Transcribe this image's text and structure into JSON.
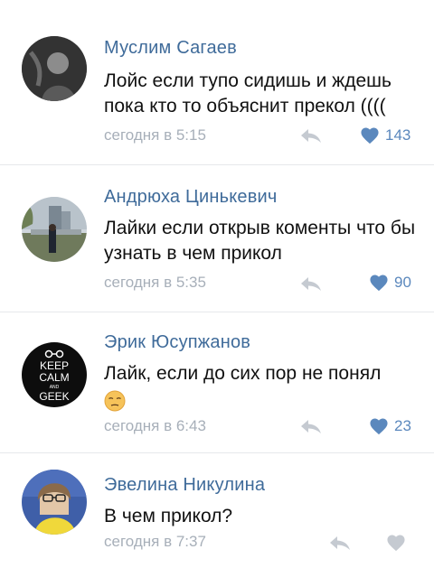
{
  "comments": [
    {
      "author": "Муслим Сагаев",
      "text": "Лойс если тупо сидишь и ждешь пока кто то объяснит прекол ((((",
      "time": "сегодня в 5:15",
      "likes": "143",
      "liked": true
    },
    {
      "author": "Андрюха Цинькевич",
      "text": "Лайки если открыв коменты что бы узнать в чем прикол",
      "time": "сегодня в 5:35",
      "likes": "90",
      "liked": true
    },
    {
      "author": "Эрик Юсупжанов",
      "text": "Лайк, если до сих пор не понял",
      "emoji": "unamused-face",
      "time": "сегодня в 6:43",
      "likes": "23",
      "liked": true,
      "avatar_text": [
        "KEEP",
        "CALM",
        "AND",
        "GEEK"
      ]
    },
    {
      "author": "Эвелина Никулина",
      "text": "В чем прикол?",
      "time": "сегодня в 7:37",
      "likes": "",
      "liked": false
    }
  ],
  "colors": {
    "author": "#3f6b9a",
    "like_active": "#5b88bd",
    "icon_inactive": "#c5cad1",
    "time": "#a7afb9",
    "divider": "#e6e8eb"
  }
}
